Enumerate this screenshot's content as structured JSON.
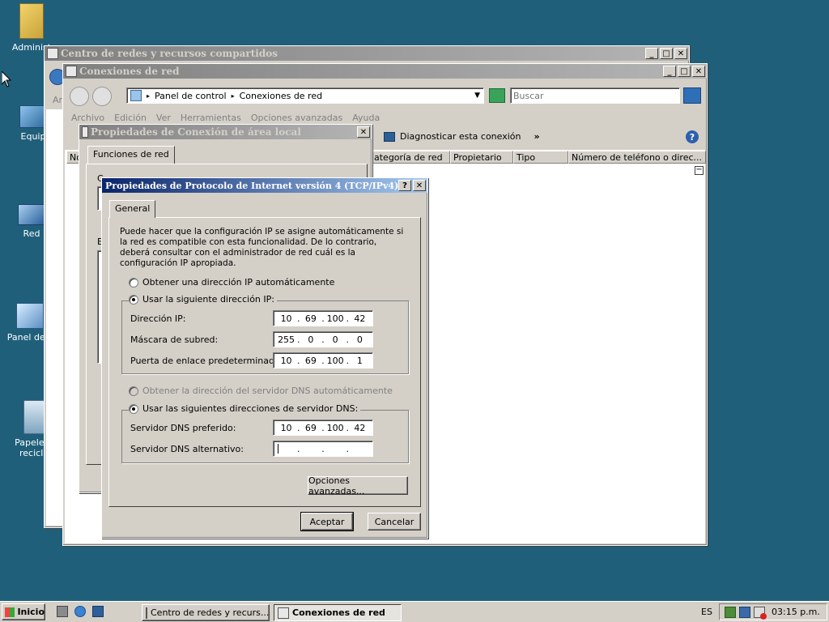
{
  "desktop": {
    "icons": [
      {
        "label": "Administ"
      },
      {
        "label": "Equip"
      },
      {
        "label": "Red"
      },
      {
        "label": "Panel de c"
      },
      {
        "label": "Papelera recicla"
      }
    ]
  },
  "win_network_center": {
    "title": "Centro de redes y recursos compartidos",
    "fragment": "Ar"
  },
  "win_connections": {
    "title": "Conexiones de red",
    "address": {
      "item1": "Panel de control",
      "item2": "Conexiones de red"
    },
    "search_placeholder": "Buscar",
    "menu": [
      "Archivo",
      "Edición",
      "Ver",
      "Herramientas",
      "Opciones avanzadas",
      "Ayuda"
    ],
    "toolbar": {
      "diagnose": "Diagnosticar esta conexión",
      "more": "»"
    },
    "columns": {
      "c0": "No",
      "c1": "ategoría de red",
      "c2": "Propietario",
      "c3": "Tipo",
      "c4": "Número de teléfono o direc..."
    }
  },
  "win_lan_props": {
    "title": "Propiedades de Conexión de área local",
    "tab": "Funciones de red",
    "frag1": "C",
    "frag2": "E"
  },
  "dialog_ipv4": {
    "title": "Propiedades de Protocolo de Internet versión 4 (TCP/IPv4)",
    "help_btn": "?",
    "close_btn": "✕",
    "tab": "General",
    "description": "Puede hacer que la configuración IP se asigne automáticamente si la red es compatible con esta funcionalidad. De lo contrario, deberá consultar con el administrador de red cuál es la configuración IP apropiada.",
    "radio_auto_ip": "Obtener una dirección IP automáticamente",
    "radio_static_ip": "Usar la siguiente dirección IP:",
    "ip_label": "Dirección IP:",
    "ip": [
      "10",
      "69",
      "100",
      "42"
    ],
    "mask_label": "Máscara de subred:",
    "mask": [
      "255",
      "0",
      "0",
      "0"
    ],
    "gateway_label": "Puerta de enlace predeterminada:",
    "gateway": [
      "10",
      "69",
      "100",
      "1"
    ],
    "radio_auto_dns": "Obtener la dirección del servidor DNS automáticamente",
    "radio_static_dns": "Usar las siguientes direcciones de servidor DNS:",
    "dns_pref_label": "Servidor DNS preferido:",
    "dns_pref": [
      "10",
      "69",
      "100",
      "42"
    ],
    "dns_alt_label": "Servidor DNS alternativo:",
    "dns_alt": [
      "",
      "",
      "",
      ""
    ],
    "advanced_btn": "Opciones avanzadas...",
    "ok_btn": "Aceptar",
    "cancel_btn": "Cancelar"
  },
  "taskbar": {
    "start": "Inicio",
    "task1": "Centro de redes y recurs...",
    "task2": "Conexiones de red",
    "lang": "ES",
    "clock": "03:15 p.m."
  }
}
